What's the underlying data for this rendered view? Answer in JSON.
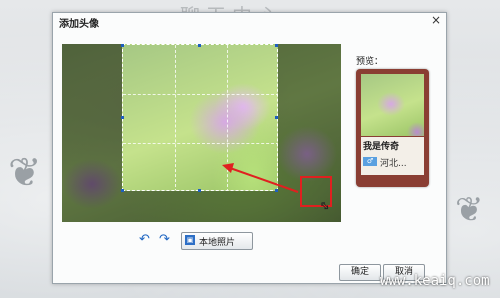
{
  "background": {
    "title": "聊天中心"
  },
  "dialog": {
    "title": "添加头像",
    "close_glyph": "×",
    "undo_glyph": "↶",
    "redo_glyph": "↷",
    "local_photo_label": "本地照片",
    "local_photo_icon": "image-icon",
    "preview": {
      "label": "预览：",
      "name": "我是传奇",
      "gender_glyph": "♂",
      "region": "河北..."
    },
    "ok_label": "确定",
    "cancel_label": "取消"
  },
  "watermark": "www.keaiq.com",
  "colors": {
    "accent_blue": "#1e5fbf",
    "highlight_red": "#e02020",
    "card_frame": "#8a3e33"
  }
}
